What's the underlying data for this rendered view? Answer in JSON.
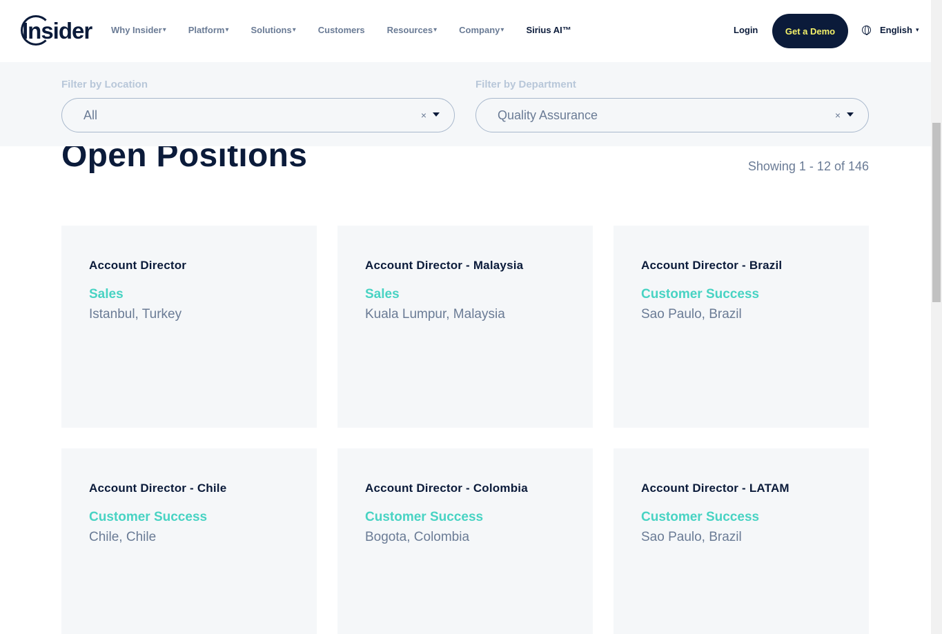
{
  "header": {
    "logo_text": "Insider",
    "nav": [
      {
        "label": "Why Insider",
        "caret": "▾"
      },
      {
        "label": "Platform",
        "caret": "▾"
      },
      {
        "label": "Solutions",
        "caret": "▾"
      },
      {
        "label": "Customers",
        "caret": ""
      },
      {
        "label": "Resources",
        "caret": "▾"
      },
      {
        "label": "Company",
        "caret": "▾"
      },
      {
        "label": "Sirius AI™",
        "caret": ""
      }
    ],
    "login": "Login",
    "demo": "Get a Demo",
    "language": "English",
    "language_caret": "▾"
  },
  "filters": {
    "location": {
      "label": "Filter by Location",
      "value": "All",
      "clear": "×"
    },
    "department": {
      "label": "Filter by Department",
      "value": "Quality Assurance",
      "clear": "×"
    }
  },
  "main": {
    "title": "Open Positions",
    "showing": "Showing 1 - 12 of 146"
  },
  "jobs": [
    {
      "title": "Account Director",
      "department": "Sales",
      "location": "Istanbul, Turkey"
    },
    {
      "title": "Account Director - Malaysia",
      "department": "Sales",
      "location": "Kuala Lumpur, Malaysia"
    },
    {
      "title": "Account Director - Brazil",
      "department": "Customer Success",
      "location": "Sao Paulo, Brazil"
    },
    {
      "title": "Account Director - Chile",
      "department": "Customer Success",
      "location": "Chile, Chile"
    },
    {
      "title": "Account Director - Colombia",
      "department": "Customer Success",
      "location": "Bogota, Colombia"
    },
    {
      "title": "Account Director - LATAM",
      "department": "Customer Success",
      "location": "Sao Paulo, Brazil"
    }
  ],
  "colors": {
    "navy": "#0b1b3a",
    "teal": "#48d3c3",
    "gray_text": "#6a7b95",
    "card_bg": "#f5f7f9",
    "demo_text": "#f5f26a"
  }
}
